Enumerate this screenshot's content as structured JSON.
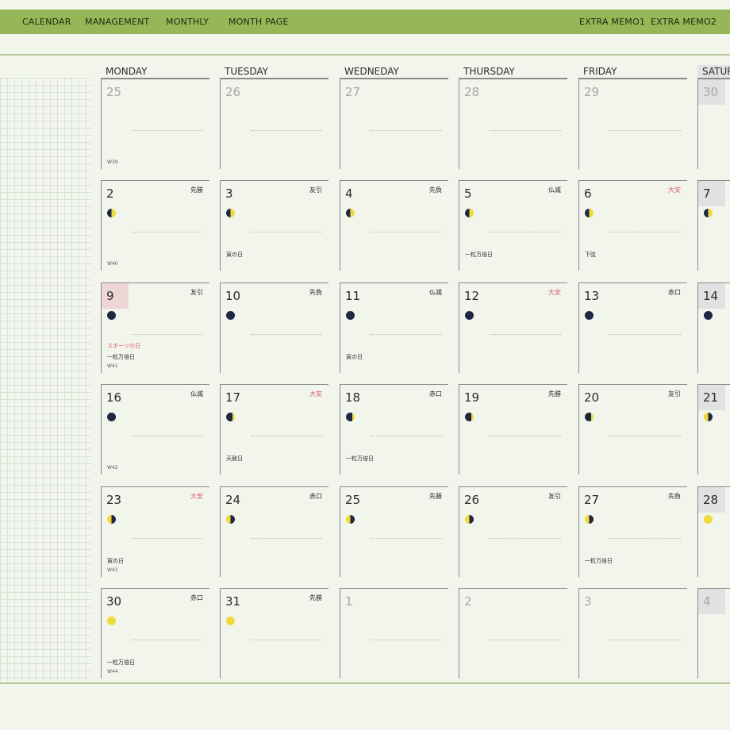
{
  "nav": {
    "left": [
      "CALENDAR",
      "MANAGEMENT",
      "MONTHLY",
      "MONTH PAGE"
    ],
    "right": [
      "EXTRA MEMO1",
      "EXTRA MEMO2"
    ]
  },
  "weekdays": [
    "MONDAY",
    "TUESDAY",
    "WEDNEDAY",
    "THURSDAY",
    "FRIDAY",
    "SATURDAY"
  ],
  "weeks": [
    {
      "week": "W39",
      "days": [
        {
          "num": "25",
          "other": true
        },
        {
          "num": "26",
          "other": true
        },
        {
          "num": "27",
          "other": true
        },
        {
          "num": "28",
          "other": true
        },
        {
          "num": "29",
          "other": true
        },
        {
          "num": "30",
          "other": true,
          "sat": true
        }
      ]
    },
    {
      "week": "W40",
      "days": [
        {
          "num": "2",
          "rokuyo": "先勝",
          "moon": "half"
        },
        {
          "num": "3",
          "rokuyo": "友引",
          "moon": "half",
          "events": [
            "寅の日"
          ]
        },
        {
          "num": "4",
          "rokuyo": "先負",
          "moon": "half"
        },
        {
          "num": "5",
          "rokuyo": "仏滅",
          "moon": "half",
          "events": [
            "一粒万倍日"
          ]
        },
        {
          "num": "6",
          "rokuyo": "大安",
          "rokuyo_red": true,
          "moon": "half",
          "events": [
            "下弦"
          ]
        },
        {
          "num": "7",
          "moon": "half",
          "sat": true
        }
      ]
    },
    {
      "week": "W41",
      "days": [
        {
          "num": "9",
          "rokuyo": "友引",
          "moon": "dark",
          "sun": true,
          "events": [
            {
              "text": "スポーツの日",
              "red": true
            },
            "一粒万倍日"
          ]
        },
        {
          "num": "10",
          "rokuyo": "先負",
          "moon": "dark"
        },
        {
          "num": "11",
          "rokuyo": "仏滅",
          "moon": "dark",
          "events": [
            "寅の日"
          ]
        },
        {
          "num": "12",
          "rokuyo": "大安",
          "rokuyo_red": true,
          "moon": "dark"
        },
        {
          "num": "13",
          "rokuyo": "赤口",
          "moon": "dark"
        },
        {
          "num": "14",
          "moon": "dark",
          "sat": true
        }
      ]
    },
    {
      "week": "W42",
      "days": [
        {
          "num": "16",
          "rokuyo": "仏滅",
          "moon": "dark"
        },
        {
          "num": "17",
          "rokuyo": "大安",
          "rokuyo_red": true,
          "moon": "cres",
          "events": [
            "天赦日"
          ]
        },
        {
          "num": "18",
          "rokuyo": "赤口",
          "moon": "cres",
          "events": [
            "一粒万倍日"
          ]
        },
        {
          "num": "19",
          "rokuyo": "先勝",
          "moon": "cres"
        },
        {
          "num": "20",
          "rokuyo": "友引",
          "moon": "cres"
        },
        {
          "num": "21",
          "moon": "halfr",
          "sat": true
        }
      ]
    },
    {
      "week": "W43",
      "days": [
        {
          "num": "23",
          "rokuyo": "大安",
          "rokuyo_red": true,
          "moon": "halfr",
          "events": [
            "寅の日"
          ]
        },
        {
          "num": "24",
          "rokuyo": "赤口",
          "moon": "halfr"
        },
        {
          "num": "25",
          "rokuyo": "先勝",
          "moon": "halfr"
        },
        {
          "num": "26",
          "rokuyo": "友引",
          "moon": "halfr"
        },
        {
          "num": "27",
          "rokuyo": "先負",
          "moon": "halfr",
          "events": [
            "一粒万倍日"
          ]
        },
        {
          "num": "28",
          "moon": "full",
          "sat": true
        }
      ]
    },
    {
      "week": "W44",
      "days": [
        {
          "num": "30",
          "rokuyo": "赤口",
          "moon": "full",
          "events": [
            "一粒万倍日"
          ]
        },
        {
          "num": "31",
          "rokuyo": "先勝",
          "moon": "full"
        },
        {
          "num": "1",
          "other": true
        },
        {
          "num": "2",
          "other": true
        },
        {
          "num": "3",
          "other": true
        },
        {
          "num": "4",
          "other": true,
          "sat": true
        }
      ]
    }
  ]
}
